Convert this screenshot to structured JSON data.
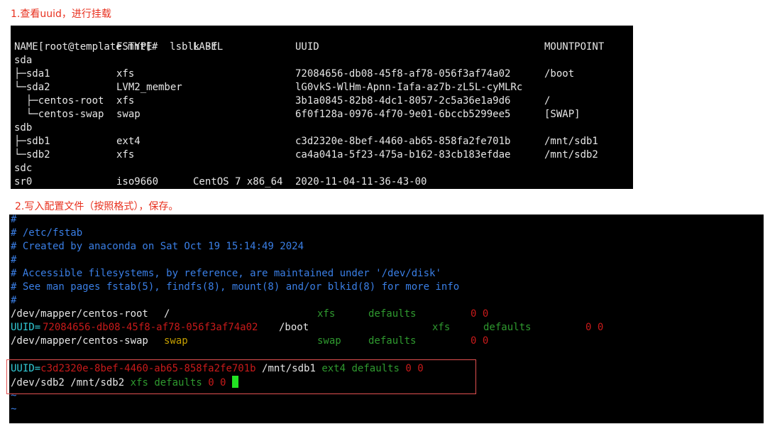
{
  "captions": {
    "step1": "1.查看uuid，进行挂载",
    "step2": "2.写入配置文件（按照格式），保存。"
  },
  "lsblk": {
    "prompt": "[root@template mnt]#  lsblk -f",
    "headers": {
      "name": "NAME",
      "fstype": "FSTYPE",
      "label": "LABEL",
      "uuid": "UUID",
      "mountpoint": "MOUNTPOINT"
    },
    "rows": [
      {
        "name": "sda",
        "fstype": "",
        "label": "",
        "uuid": "",
        "mountpoint": ""
      },
      {
        "name": "├─sda1",
        "fstype": "xfs",
        "label": "",
        "uuid": "72084656-db08-45f8-af78-056f3af74a02",
        "mountpoint": "/boot"
      },
      {
        "name": "└─sda2",
        "fstype": "LVM2_member",
        "label": "",
        "uuid": "lG0vkS-WlHm-Apnn-Iafa-az7b-zL5L-cyMLRc",
        "mountpoint": ""
      },
      {
        "name": "  ├─centos-root",
        "fstype": "xfs",
        "label": "",
        "uuid": "3b1a0845-82b8-4dc1-8057-2c5a36e1a9d6",
        "mountpoint": "/"
      },
      {
        "name": "  └─centos-swap",
        "fstype": "swap",
        "label": "",
        "uuid": "6f0f128a-0976-4f70-9e01-6bccb5299ee5",
        "mountpoint": "[SWAP]"
      },
      {
        "name": "sdb",
        "fstype": "",
        "label": "",
        "uuid": "",
        "mountpoint": ""
      },
      {
        "name": "├─sdb1",
        "fstype": "ext4",
        "label": "",
        "uuid": "c3d2320e-8bef-4460-ab65-858fa2fe701b",
        "mountpoint": "/mnt/sdb1"
      },
      {
        "name": "└─sdb2",
        "fstype": "xfs",
        "label": "",
        "uuid": "ca4a041a-5f23-475a-b162-83cb183efdae",
        "mountpoint": "/mnt/sdb2"
      },
      {
        "name": "sdc",
        "fstype": "",
        "label": "",
        "uuid": "",
        "mountpoint": ""
      },
      {
        "name": "sr0",
        "fstype": "iso9660",
        "label": "CentOS 7 x86_64",
        "uuid": "2020-11-04-11-36-43-00",
        "mountpoint": ""
      }
    ]
  },
  "fstab": {
    "comments": [
      "#",
      "# /etc/fstab",
      "# Created by anaconda on Sat Oct 19 15:14:49 2024",
      "#",
      "# Accessible filesystems, by reference, are maintained under '/dev/disk'",
      "# See man pages fstab(5), findfs(8), mount(8) and/or blkid(8) for more info",
      "#"
    ],
    "entries": [
      {
        "device": "/dev/mapper/centos-root",
        "mount": "/",
        "type": "xfs",
        "options": "defaults",
        "dump_pass": "0 0"
      },
      {
        "uuid_key": "UUID=",
        "uuid_val": "72084656-db08-45f8-af78-056f3af74a02",
        "mount": "/boot",
        "type": "xfs",
        "options": "defaults",
        "dump_pass": "0 0"
      },
      {
        "device": "/dev/mapper/centos-swap",
        "mount": "swap",
        "type": "swap",
        "options": "defaults",
        "dump_pass": "0 0"
      }
    ],
    "new_entries": {
      "sdb1": {
        "uuid_key": "UUID=",
        "uuid_val": "c3d2320e-8bef-4460-ab65-858fa2fe701b",
        "mount": "/mnt/sdb1",
        "type": "ext4",
        "options": "defaults",
        "dump_pass": "0 0"
      },
      "sdb2": {
        "device": "/dev/sdb2",
        "mount": "/mnt/sdb2",
        "type": "xfs",
        "options": "defaults",
        "dump_pass": "0 0"
      }
    },
    "tildes": [
      "~",
      "~"
    ]
  },
  "colors": {
    "caption": "#e8301e",
    "comment": "#3a7fe6",
    "uuid_value": "#c81a1a",
    "fs_field": "#2f9a2f",
    "swap_mount": "#c6a000",
    "uuid_key": "#32ccd8",
    "cursor": "#22e322",
    "highlight_box": "#e25050"
  }
}
